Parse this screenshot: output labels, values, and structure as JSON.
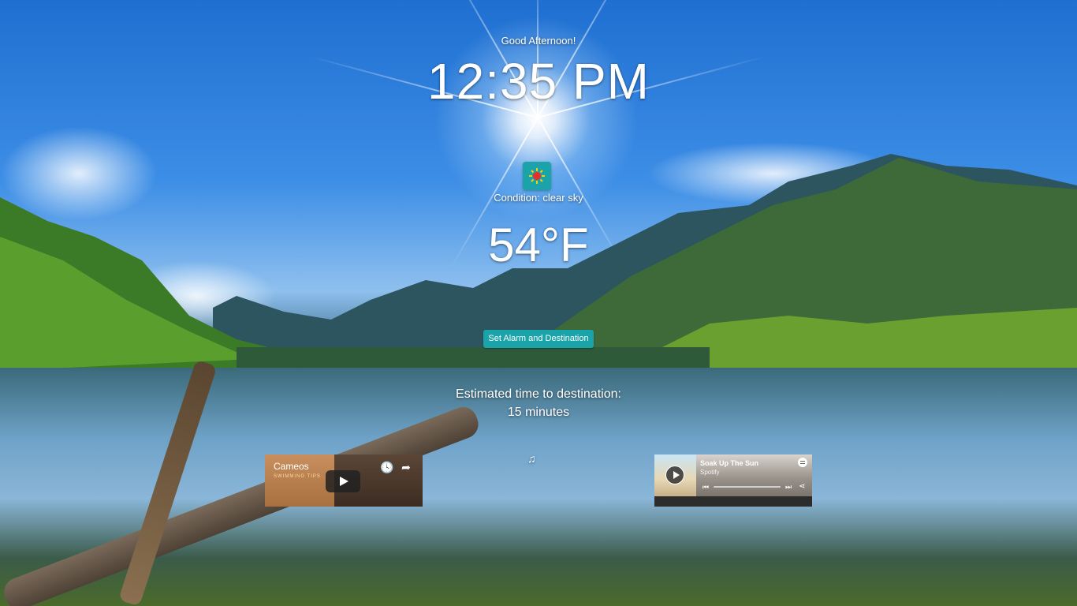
{
  "greeting": "Good Afternoon!",
  "clock": "12:35 PM",
  "weather": {
    "icon": "sun-icon",
    "condition": "Condition: clear sky",
    "temperature": "54°F"
  },
  "alarm_button_label": "Set Alarm and Destination",
  "eta": {
    "label": "Estimated time to destination:",
    "value": "15 minutes"
  },
  "music_icon": "music-note-icon",
  "video": {
    "title": "Cameos",
    "subtitle": "SWIMMING TIPS",
    "icons": [
      "watch-later-icon",
      "share-icon",
      "play-icon"
    ]
  },
  "spotify": {
    "track": "Soak Up The Sun",
    "artist": "Spotify",
    "icons": [
      "play-icon",
      "spotify-logo-icon",
      "previous-icon",
      "next-icon",
      "share-icon"
    ]
  },
  "colors": {
    "accent": "#1aa3a8",
    "text": "#ffffff"
  }
}
